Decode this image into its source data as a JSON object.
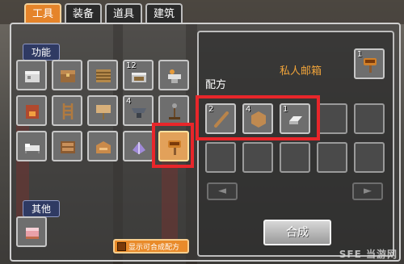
{
  "tabs": [
    {
      "label": "工具",
      "active": true
    },
    {
      "label": "装备",
      "active": false
    },
    {
      "label": "道具",
      "active": false
    },
    {
      "label": "建筑",
      "active": false
    }
  ],
  "left_panel": {
    "function_label": "功能",
    "other_label": "其他",
    "function_items": [
      {
        "name": "crafting-table",
        "count": ""
      },
      {
        "name": "chest",
        "count": ""
      },
      {
        "name": "wood-crate",
        "count": ""
      },
      {
        "name": "cooking-station",
        "count": "12"
      },
      {
        "name": "anvil-table",
        "count": ""
      },
      {
        "name": "furnace",
        "count": ""
      },
      {
        "name": "ladder",
        "count": ""
      },
      {
        "name": "signboard",
        "count": ""
      },
      {
        "name": "iron-anvil",
        "count": "4"
      },
      {
        "name": "lamp-stand",
        "count": ""
      },
      {
        "name": "bed",
        "count": ""
      },
      {
        "name": "storage-box",
        "count": ""
      },
      {
        "name": "workbench",
        "count": ""
      },
      {
        "name": "magic-item",
        "count": ""
      },
      {
        "name": "mailbox",
        "count": "",
        "selected": true
      }
    ],
    "other_items": [
      {
        "name": "cake-box",
        "count": ""
      }
    ],
    "show_craftable_label": "显示可合成配方"
  },
  "right_panel": {
    "mailbox_label": "私人邮箱",
    "result_count": "1",
    "recipe_label": "配方",
    "ingredients": [
      {
        "name": "wood-stick",
        "count": "2"
      },
      {
        "name": "wood-plank",
        "count": "4"
      },
      {
        "name": "iron-ingot",
        "count": "1"
      }
    ],
    "empty_slots_row1": 2,
    "empty_slots_row2": 5,
    "prev_arrow": "◄",
    "next_arrow": "►",
    "craft_label": "合成"
  },
  "watermark": "SFE 当游网",
  "colors": {
    "accent": "#e5842a",
    "highlight_box": "#e8262a",
    "label_orange": "#f1a43a"
  }
}
